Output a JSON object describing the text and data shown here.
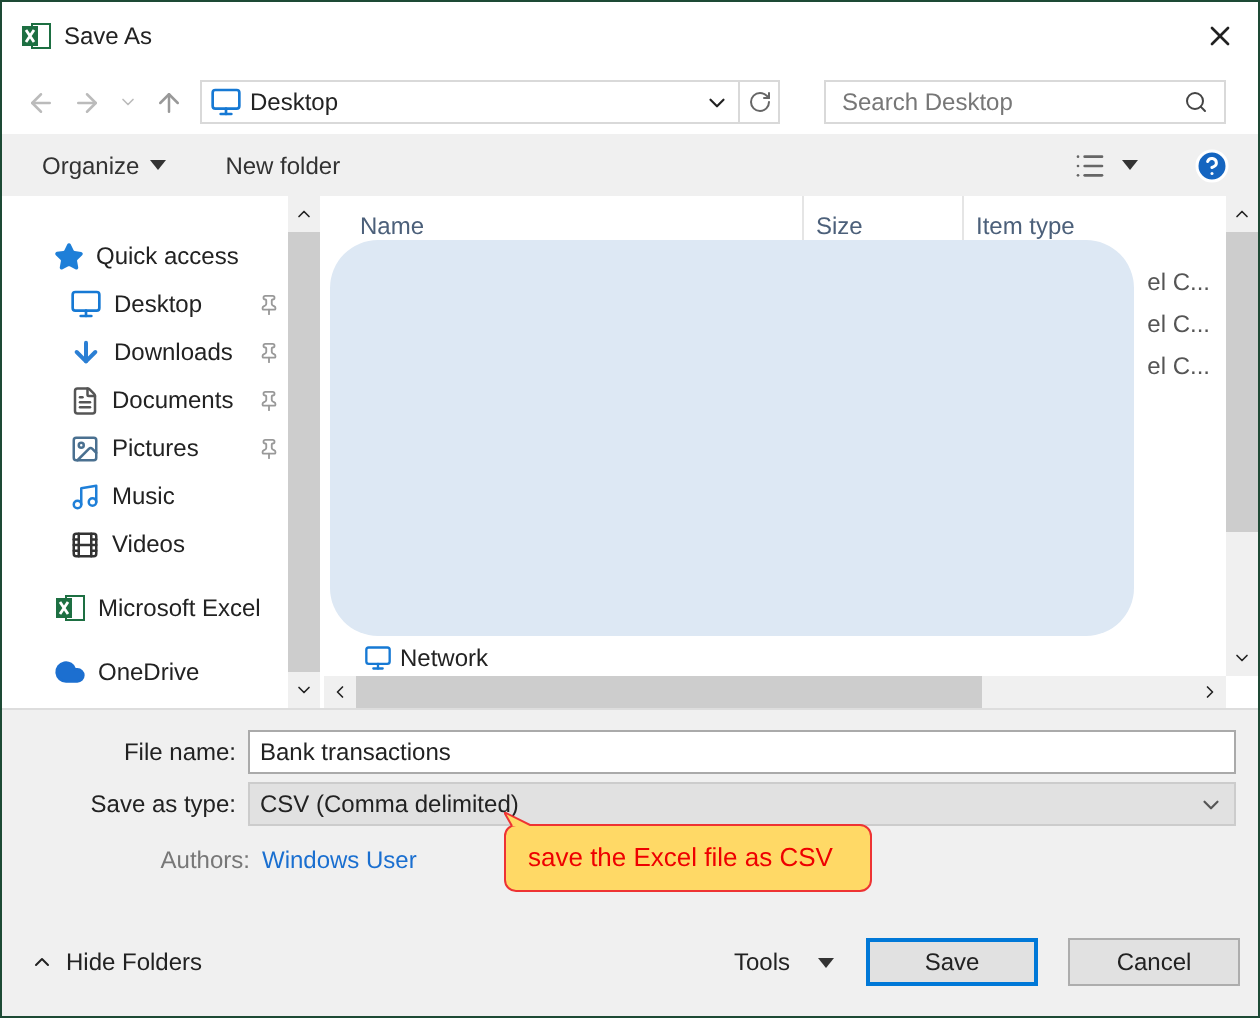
{
  "window": {
    "title": "Save As"
  },
  "address": {
    "location": "Desktop",
    "search_placeholder": "Search Desktop"
  },
  "toolbar": {
    "organize": "Organize",
    "new_folder": "New folder"
  },
  "nav": [
    {
      "label": "Quick access",
      "kind": "quick",
      "pinned": false
    },
    {
      "label": "Desktop",
      "kind": "desktop",
      "pinned": true
    },
    {
      "label": "Downloads",
      "kind": "downloads",
      "pinned": true
    },
    {
      "label": "Documents",
      "kind": "documents",
      "pinned": true
    },
    {
      "label": "Pictures",
      "kind": "pictures",
      "pinned": true
    },
    {
      "label": "Music",
      "kind": "music",
      "pinned": false
    },
    {
      "label": "Videos",
      "kind": "videos",
      "pinned": false
    },
    {
      "label": "Microsoft Excel",
      "kind": "excel",
      "pinned": false
    },
    {
      "label": "OneDrive",
      "kind": "onedrive",
      "pinned": false
    }
  ],
  "table": {
    "columns": [
      "Name",
      "Size",
      "Item type"
    ],
    "rows": [
      {
        "item_type": "el C..."
      },
      {
        "item_type": "el C..."
      },
      {
        "item_type": "el C..."
      }
    ],
    "last_item": "Network"
  },
  "form": {
    "file_name_label": "File name:",
    "file_name": "Bank transactions",
    "type_label": "Save as type:",
    "type": "CSV (Comma delimited)",
    "authors_label": "Authors:",
    "authors": "Windows User"
  },
  "callout": "save the Excel file as CSV",
  "footer": {
    "hide_folders": "Hide Folders",
    "tools": "Tools",
    "save": "Save",
    "cancel": "Cancel"
  }
}
